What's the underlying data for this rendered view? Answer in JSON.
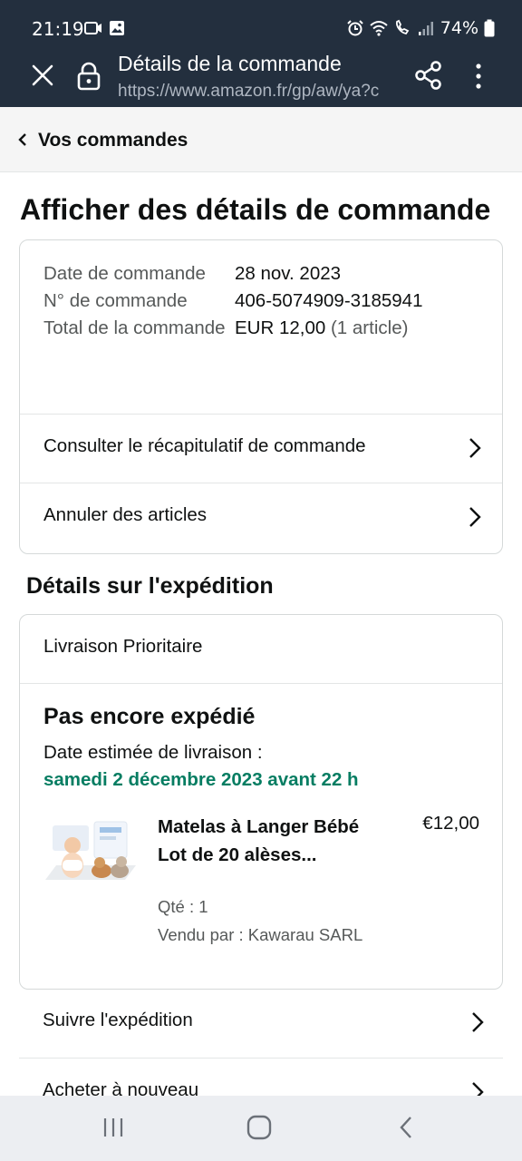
{
  "status_bar": {
    "time": "21:19",
    "battery": "74%"
  },
  "browser": {
    "title": "Détails de la commande",
    "url": "https://www.amazon.fr/gp/aw/ya?c"
  },
  "back_nav": {
    "label": "Vos commandes"
  },
  "page_title": "Afficher des détails de commande",
  "order_info": {
    "date_label": "Date de commande",
    "date_value": "28 nov. 2023",
    "number_label": "N° de commande",
    "number_value": "406-5074909-3185941",
    "total_label": "Total de la commande",
    "total_value": "EUR 12,00",
    "total_items": "(1 article)",
    "summary_link": "Consulter le récapitulatif de commande",
    "cancel_link": "Annuler des articles"
  },
  "shipping": {
    "section_title": "Détails sur l'expédition",
    "method": "Livraison Prioritaire",
    "status": "Pas encore expédié",
    "eta_label": "Date estimée de livraison :",
    "eta_value": "samedi 2 décembre 2023 avant 22 h",
    "product": {
      "name": "Matelas à Langer Bébé Lot de 20 alèses...",
      "price": "€12,00",
      "qty": "Qté : 1",
      "seller": "Vendu par : Kawarau SARL"
    },
    "track_link": "Suivre l'expédition",
    "buy_again_link": "Acheter à nouveau"
  },
  "colors": {
    "header_bg": "#232f3e",
    "eta_green": "#067d62"
  }
}
